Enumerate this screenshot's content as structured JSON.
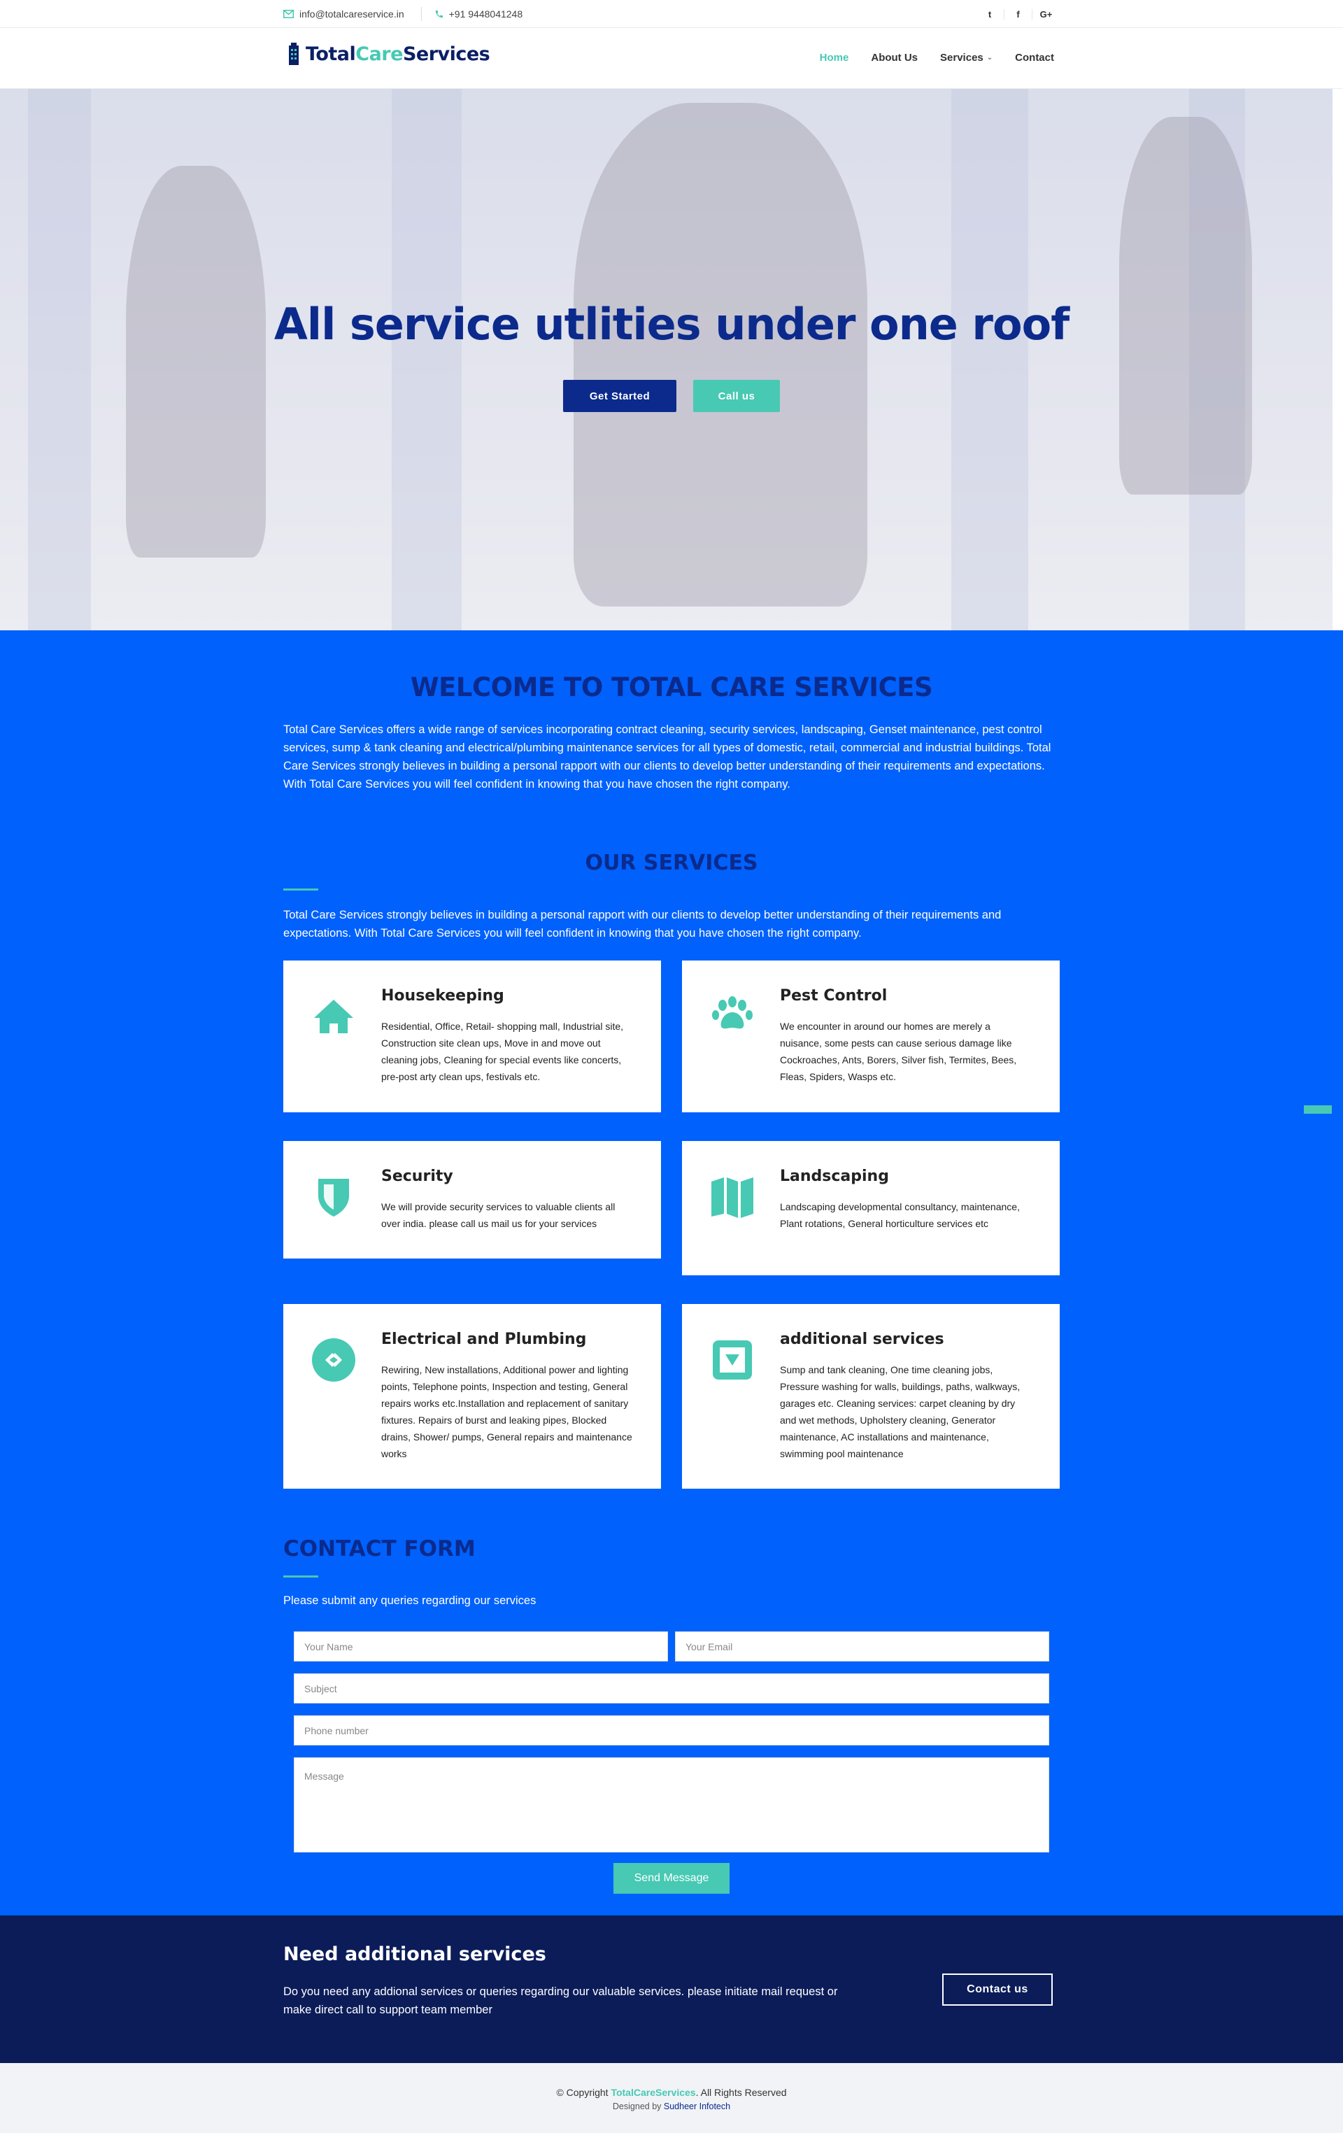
{
  "topbar": {
    "email": "info@totalcareservice.in",
    "phone": "+91 9448041248",
    "social": [
      "twitter-icon",
      "facebook-icon",
      "google-plus-icon"
    ],
    "social_labels": {
      "twitter": "t",
      "facebook": "f",
      "google": "G+"
    }
  },
  "header": {
    "logo_part1": "Total",
    "logo_part2": "Care",
    "logo_part3": "Services",
    "nav": {
      "home": "Home",
      "about": "About Us",
      "services": "Services",
      "contact": "Contact"
    }
  },
  "hero": {
    "title": "All service utlities under one roof",
    "btn_primary": "Get Started",
    "btn_secondary": "Call us"
  },
  "welcome": {
    "title": "WELCOME TO TOTAL CARE SERVICES",
    "text": "Total Care Services offers a wide range of services incorporating contract cleaning, security services, landscaping, Genset maintenance, pest control services, sump & tank cleaning and electrical/plumbing maintenance services for all types of domestic, retail, commercial and industrial buildings. Total Care Services strongly believes in building a personal rapport with our clients to develop better understanding of their requirements and expectations. With Total Care Services you will feel confident in knowing that you have chosen the right company."
  },
  "services": {
    "title": "OUR SERVICES",
    "intro": "Total Care Services strongly believes in building a personal rapport with our clients to develop better understanding of their requirements and expectations. With Total Care Services you will feel confident in knowing that you have chosen the right company.",
    "items": [
      {
        "title": "Housekeeping",
        "icon": "home-icon",
        "text": "Residential, Office, Retail- shopping mall, Industrial site, Construction site clean ups, Move in and move out cleaning jobs, Cleaning for special events like concerts, pre-post arty clean ups, festivals etc."
      },
      {
        "title": "Pest Control",
        "icon": "paw-icon",
        "text": "We encounter in around our homes are merely a nuisance, some pests can cause serious damage like Cockroaches, Ants, Borers, Silver fish, Termites, Bees, Fleas, Spiders, Wasps etc."
      },
      {
        "title": "Security",
        "icon": "shield-icon",
        "text": "We will provide security services to valuable clients all over india. please call us mail us for your services"
      },
      {
        "title": "Landscaping",
        "icon": "map-icon",
        "text": "Landscaping developmental consultancy, maintenance, Plant rotations, General horticulture services etc"
      },
      {
        "title": "Electrical and Plumbing",
        "icon": "link-icon",
        "text": "Rewiring, New installations, Additional power and lighting points, Telephone points, Inspection and testing, General repairs works etc.Installation and replacement of sanitary fixtures. Repairs of burst and leaking pipes, Blocked drains, Shower/ pumps, General repairs and maintenance works"
      },
      {
        "title": "additional services",
        "icon": "caret-down-square-icon",
        "text": "Sump and tank cleaning, One time cleaning jobs, Pressure washing for walls, buildings, paths, walkways, garages etc. Cleaning services: carpet cleaning by dry and wet methods, Upholstery cleaning, Generator maintenance, AC installations and maintenance, swimming pool maintenance"
      }
    ]
  },
  "contact": {
    "title": "CONTACT FORM",
    "subtitle": "Please submit any queries regarding our services",
    "placeholders": {
      "name": "Your Name",
      "email": "Your Email",
      "subject": "Subject",
      "phone": "Phone number",
      "message": "Message"
    },
    "send": "Send Message"
  },
  "cta": {
    "title": "Need additional services",
    "text": "Do you need any addional services or queries regarding our valuable services. please initiate mail request or make direct call to support team member",
    "button": "Contact us"
  },
  "footer": {
    "copyright_prefix": "© Copyright ",
    "brand": "TotalCareServices",
    "copyright_suffix": ". All Rights Reserved",
    "designed_prefix": "Designed by ",
    "designer": "Sudheer Infotech"
  },
  "colors": {
    "primary_blue": "#0061fd",
    "navy": "#0b2a8c",
    "teal": "#47c9b3",
    "dark": "#0b1c59"
  }
}
